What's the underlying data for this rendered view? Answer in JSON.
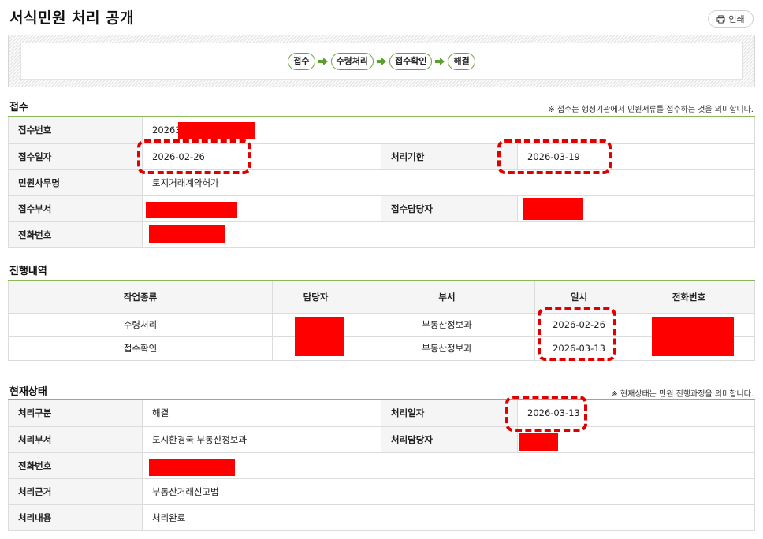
{
  "page": {
    "title": "서식민원 처리 공개",
    "print_label": "인쇄"
  },
  "steps": [
    "접수",
    "수령처리",
    "접수확인",
    "해결"
  ],
  "reception": {
    "title": "접수",
    "note": "※ 접수는 행정기관에서 민원서류를 접수하는 것을 의미합니다.",
    "receipt_no_label": "접수번호",
    "receipt_no_value": "20263",
    "receipt_date_label": "접수일자",
    "receipt_date_value": "2026-02-26",
    "deadline_label": "처리기한",
    "deadline_value": "2026-03-19",
    "office_label": "민원사무명",
    "office_value": "토지거래계약허가",
    "dept_label": "접수부서",
    "manager_label": "접수담당자",
    "phone_label": "전화번호"
  },
  "history": {
    "title": "진행내역",
    "headers": [
      "작업종류",
      "담당자",
      "부서",
      "일시",
      "전화번호"
    ],
    "rows": [
      {
        "type": "수령처리",
        "dept": "부동산정보과",
        "date": "2026-02-26"
      },
      {
        "type": "접수확인",
        "dept": "부동산정보과",
        "date": "2026-03-13"
      }
    ]
  },
  "status": {
    "title": "현재상태",
    "note": "※ 현재상태는 민원 진행과정을 의미합니다.",
    "category_label": "처리구분",
    "category_value": "해결",
    "processed_date_label": "처리일자",
    "processed_date_value": "2026-03-13",
    "dept_label": "처리부서",
    "dept_value": "도시환경국 부동산정보과",
    "manager_label": "처리담당자",
    "phone_label": "전화번호",
    "basis_label": "처리근거",
    "basis_value": "부동산거래신고법",
    "content_label": "처리내용",
    "content_value": "처리완료"
  },
  "colors": {
    "accent_line": "#8cb85c",
    "step_border": "#6aa33a",
    "arrow": "#5aa02c",
    "redaction": "#ff0000",
    "highlight": "#e00000"
  }
}
